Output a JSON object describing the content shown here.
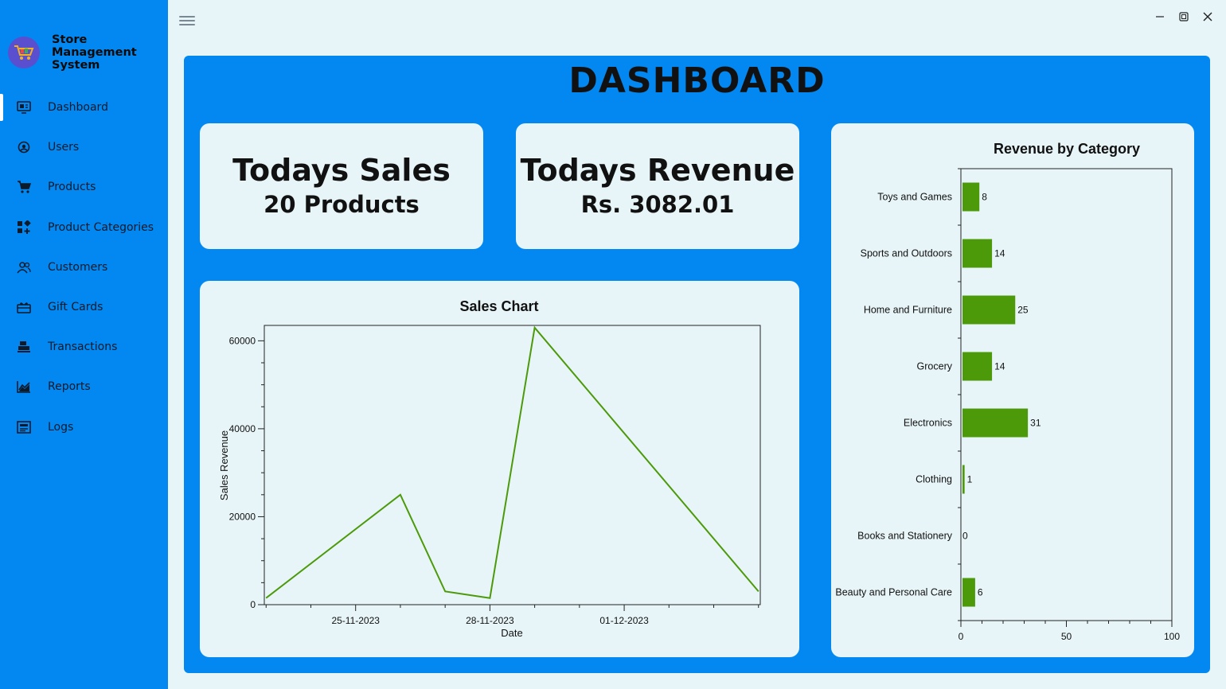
{
  "app": {
    "brand_lines": [
      "Store",
      "Management",
      "System"
    ]
  },
  "sidebar": {
    "items": [
      {
        "label": "Dashboard",
        "icon": "dashboard-icon",
        "active": true
      },
      {
        "label": "Users",
        "icon": "users-icon"
      },
      {
        "label": "Products",
        "icon": "cart-icon"
      },
      {
        "label": "Product Categories",
        "icon": "categories-icon"
      },
      {
        "label": "Customers",
        "icon": "customers-icon"
      },
      {
        "label": "Gift Cards",
        "icon": "gift-card-icon"
      },
      {
        "label": "Transactions",
        "icon": "register-icon"
      },
      {
        "label": "Reports",
        "icon": "chart-icon"
      },
      {
        "label": "Logs",
        "icon": "log-icon"
      }
    ]
  },
  "main": {
    "title": "DASHBOARD",
    "todays_sales": {
      "title": "Todays Sales",
      "value": "20 Products"
    },
    "todays_revenue": {
      "title": "Todays Revenue",
      "value": "Rs. 3082.01"
    }
  },
  "colors": {
    "accent": "#0288f0",
    "card": "#e8f5f8",
    "series": "#4c9a0a"
  },
  "chart_data": [
    {
      "type": "line",
      "title": "Sales Chart",
      "xlabel": "Date",
      "ylabel": "Sales Revenue",
      "x": [
        "2023-11-23",
        "2023-11-26",
        "2023-11-27",
        "2023-11-28",
        "2023-11-29",
        "2023-12-04"
      ],
      "series": [
        {
          "values": [
            1500,
            25000,
            3000,
            1500,
            63000,
            3000
          ]
        }
      ],
      "xticks": [
        "25-11-2023",
        "28-11-2023",
        "01-12-2023"
      ],
      "yticks": [
        "0",
        "20000",
        "40000",
        "60000"
      ],
      "ylim": [
        0,
        63500
      ],
      "grid": false
    },
    {
      "type": "bar",
      "orientation": "horizontal",
      "title": "Revenue by Category",
      "categories": [
        "Toys and Games",
        "Sports and Outdoors",
        "Home and Furniture",
        "Grocery",
        "Electronics",
        "Clothing",
        "Books and Stationery",
        "Beauty and Personal Care"
      ],
      "values": [
        8,
        14,
        25,
        14,
        31,
        1,
        0,
        6
      ],
      "xticks": [
        "0",
        "50",
        "100"
      ],
      "xlim": [
        0,
        100
      ],
      "grid": false
    }
  ]
}
